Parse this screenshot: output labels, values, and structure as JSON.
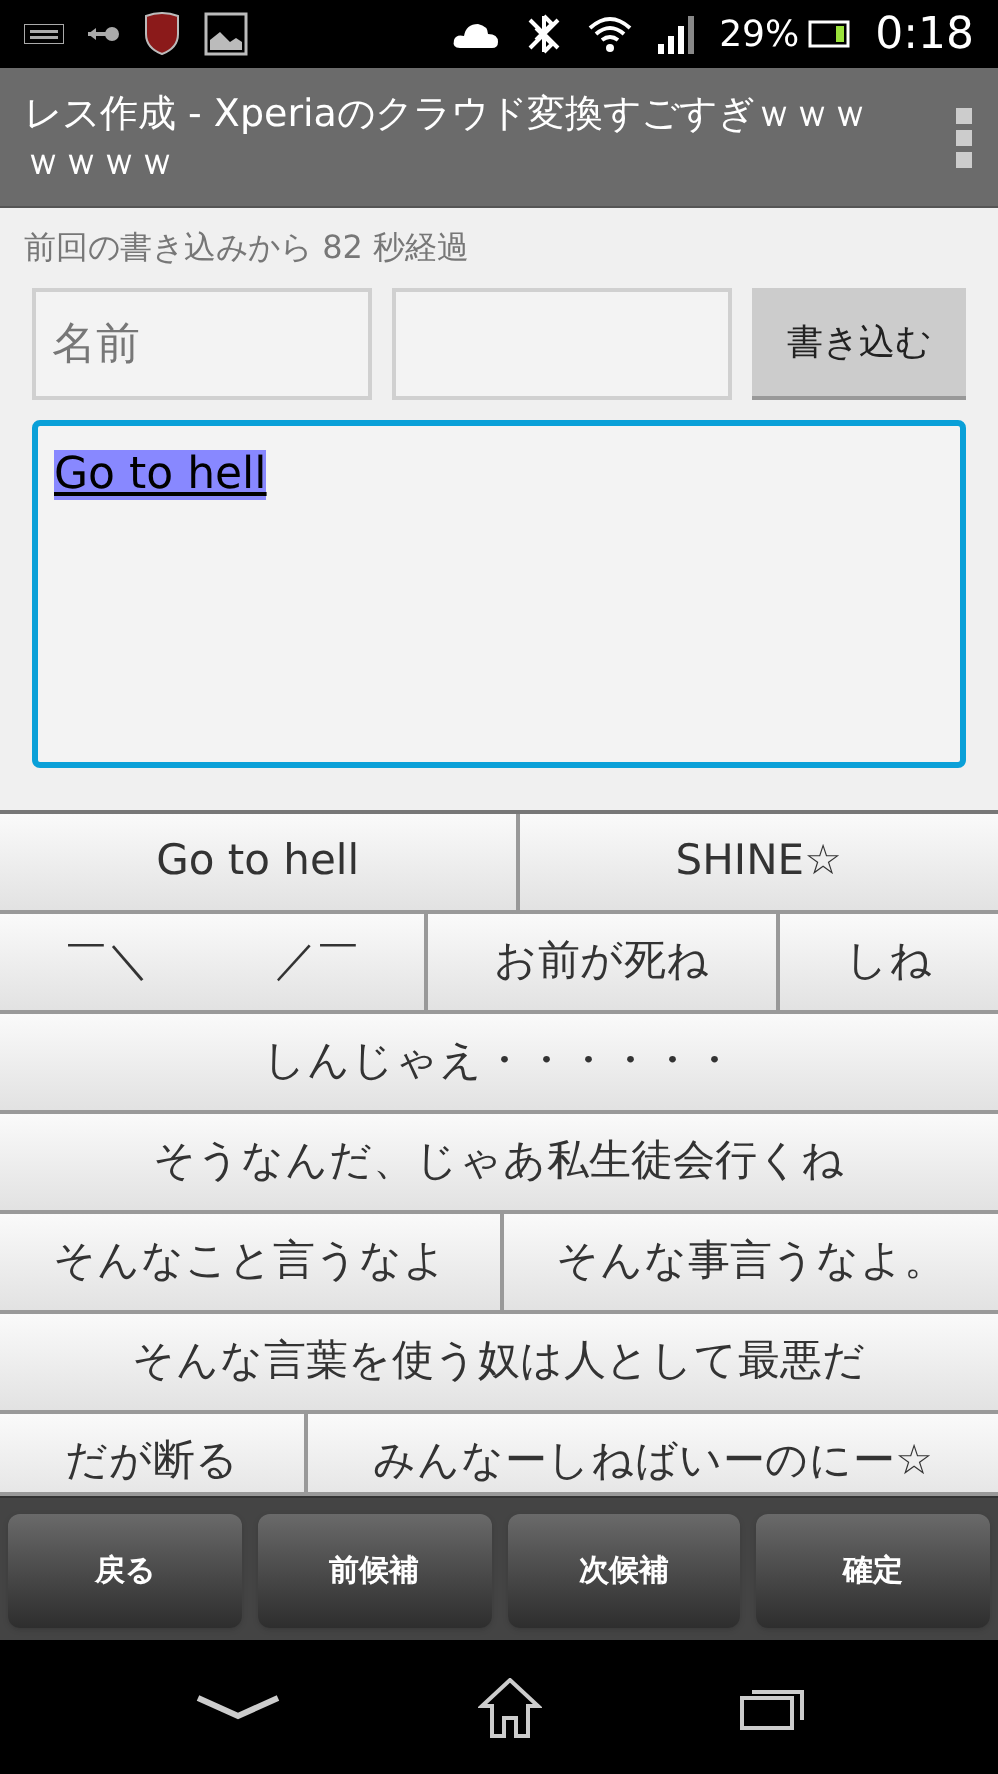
{
  "status_bar": {
    "battery_percent": "29%",
    "time": "0:18"
  },
  "action_bar": {
    "title": "レス作成 - Xperiaのクラウド変換すごすぎｗｗｗｗｗｗｗ"
  },
  "elapsed_note": "前回の書き込みから 82 秒経過",
  "name_field": {
    "placeholder": "名前"
  },
  "submit_button": "書き込む",
  "message": {
    "value": "Go to hell",
    "composing": true,
    "focused": true
  },
  "candidate_rows": [
    [
      {
        "label": "Go to hell"
      },
      {
        "label": "SHINE☆"
      }
    ],
    [
      {
        "label": "￣＼　　　／￣"
      },
      {
        "label": "お前が死ね"
      },
      {
        "label": "しね"
      }
    ],
    [
      {
        "label": "しんじゃえ・・・・・・"
      }
    ],
    [
      {
        "label": "そうなんだ、じゃあ私生徒会行くね"
      }
    ],
    [
      {
        "label": "そんなこと言うなよ"
      },
      {
        "label": "そんな事言うなよ。"
      }
    ],
    [
      {
        "label": "そんな言葉を使う奴は人として最悪だ"
      }
    ],
    [
      {
        "label": "だが断る"
      },
      {
        "label": "みんなーしねばいーのにー☆"
      }
    ]
  ],
  "ime_keys": [
    "戻る",
    "前候補",
    "次候補",
    "確定"
  ]
}
